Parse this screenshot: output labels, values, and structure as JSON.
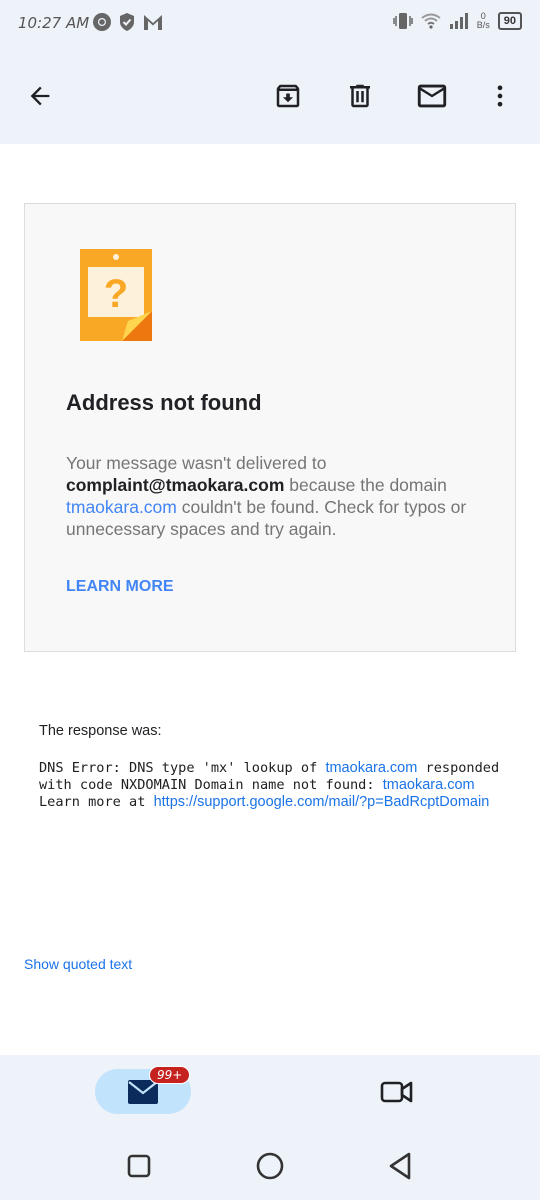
{
  "status_bar": {
    "time": "10:27 AM",
    "battery": "90",
    "speed_top": "0",
    "speed_bottom": "B/s",
    "icons": [
      "chrome-icon",
      "shield-icon",
      "gmail-m-icon",
      "vibrate-icon",
      "wifi-icon",
      "signal-icon"
    ]
  },
  "toolbar": {
    "icons": [
      "back-arrow-icon",
      "archive-icon",
      "delete-icon",
      "mark-unread-icon",
      "more-vert-icon"
    ]
  },
  "bounce": {
    "title": "Address not found",
    "message_part1": "Your message wasn't delivered to ",
    "email": "complaint@tmaokara.com",
    "message_part2": " because the domain ",
    "domain": "tmaokara.com",
    "message_part3": " couldn't be found. Check for typos or unnecessary spaces and try again.",
    "learn_more": "LEARN MORE"
  },
  "response": {
    "label": "The response was:",
    "dns_part1": "DNS Error: DNS type 'mx' lookup of ",
    "dns_domain1": "tmaokara.com",
    "dns_part2": " responded with code NXDOMAIN Domain name not found: ",
    "dns_domain2": "tmaokara.com",
    "dns_part3": " Learn more at ",
    "dns_url": "https://support.google.com/mail/?p=BadRcptDomain"
  },
  "show_quoted": "Show quoted text",
  "bottom_nav": {
    "badge": "99+"
  },
  "colors": {
    "accent_blue": "#4285f4",
    "link_blue": "#1a73e8",
    "warning_orange": "#f9a825",
    "badge_red": "#c5221f"
  }
}
